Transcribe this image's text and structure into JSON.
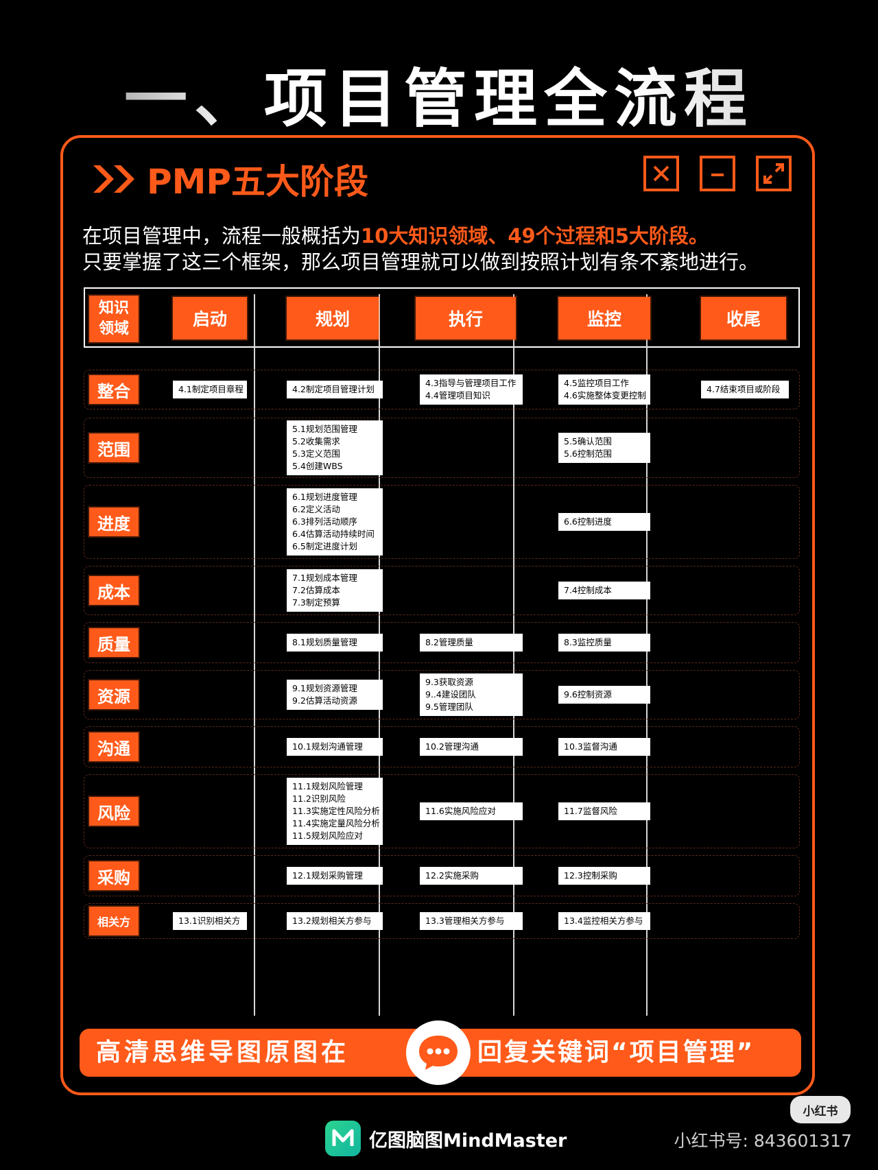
{
  "page_title": "一、项目管理全流程",
  "card": {
    "title": "PMP五大阶段",
    "intro_line1_prefix": "在项目管理中，流程一般概括为",
    "intro_line1_highlight": "10大知识领域、49个过程和5大阶段。",
    "intro_line2": "只要掌握了这三个框架，那么项目管理就可以做到按照计划有条不紊地进行。"
  },
  "window_buttons": [
    {
      "icon": "close-icon"
    },
    {
      "icon": "minimize-icon"
    },
    {
      "icon": "expand-icon"
    }
  ],
  "grid": {
    "corner_label": [
      "知识",
      "领域"
    ],
    "phases": [
      "启动",
      "规划",
      "执行",
      "监控",
      "收尾"
    ],
    "areas": [
      {
        "name": "整合",
        "cells": [
          [
            "4.1制定项目章程"
          ],
          [
            "4.2制定项目管理计划"
          ],
          [
            "4.3指导与管理项目工作",
            "4.4管理项目知识"
          ],
          [
            "4.5监控项目工作",
            "4.6实施整体变更控制"
          ],
          [
            "4.7结束项目或阶段"
          ]
        ]
      },
      {
        "name": "范围",
        "cells": [
          [],
          [
            "5.1规划范围管理",
            "5.2收集需求",
            "5.3定义范围",
            "5.4创建WBS"
          ],
          [],
          [
            "5.5确认范围",
            "5.6控制范围"
          ],
          []
        ]
      },
      {
        "name": "进度",
        "cells": [
          [],
          [
            "6.1规划进度管理",
            "6.2定义活动",
            "6.3排列活动顺序",
            "6.4估算活动持续时间",
            "6.5制定进度计划"
          ],
          [],
          [
            "6.6控制进度"
          ],
          []
        ]
      },
      {
        "name": "成本",
        "cells": [
          [],
          [
            "7.1规划成本管理",
            "7.2估算成本",
            "7.3制定预算"
          ],
          [],
          [
            "7.4控制成本"
          ],
          []
        ]
      },
      {
        "name": "质量",
        "cells": [
          [],
          [
            "8.1规划质量管理"
          ],
          [
            "8.2管理质量"
          ],
          [
            "8.3监控质量"
          ],
          []
        ]
      },
      {
        "name": "资源",
        "cells": [
          [],
          [
            "9.1规划资源管理",
            "9.2估算活动资源"
          ],
          [
            "9.3获取资源",
            "9..4建设团队",
            "9.5管理团队"
          ],
          [
            "9.6控制资源"
          ],
          []
        ]
      },
      {
        "name": "沟通",
        "cells": [
          [],
          [
            "10.1规划沟通管理"
          ],
          [
            "10.2管理沟通"
          ],
          [
            "10.3监督沟通"
          ],
          []
        ]
      },
      {
        "name": "风险",
        "cells": [
          [],
          [
            "11.1规划风险管理",
            "11.2识别风险",
            "11.3实施定性风险分析",
            "11.4实施定量风险分析",
            "11.5规划风险应对"
          ],
          [
            "11.6实施风险应对"
          ],
          [
            "11.7监督风险"
          ],
          []
        ]
      },
      {
        "name": "采购",
        "cells": [
          [],
          [
            "12.1规划采购管理"
          ],
          [
            "12.2实施采购"
          ],
          [
            "12.3控制采购"
          ],
          []
        ]
      },
      {
        "name": "相关方",
        "cells": [
          [
            "13.1识别相关方"
          ],
          [
            "13.2规划相关方参与"
          ],
          [
            "13.3管理相关方参与"
          ],
          [
            "13.4监控相关方参与"
          ],
          []
        ]
      }
    ]
  },
  "cta": {
    "left": "高清思维导图原图在",
    "right": "回复关键词“项目管理”",
    "icon": "chat-bubble-icon"
  },
  "footer": {
    "logo_text": "亿图脑图MindMaster",
    "logo_icon": "mindmaster-logo-icon",
    "badge": "小红书",
    "xhs_id": "小红书号: 843601317"
  },
  "colors": {
    "accent": "#ff5a1a",
    "background": "#000000"
  }
}
